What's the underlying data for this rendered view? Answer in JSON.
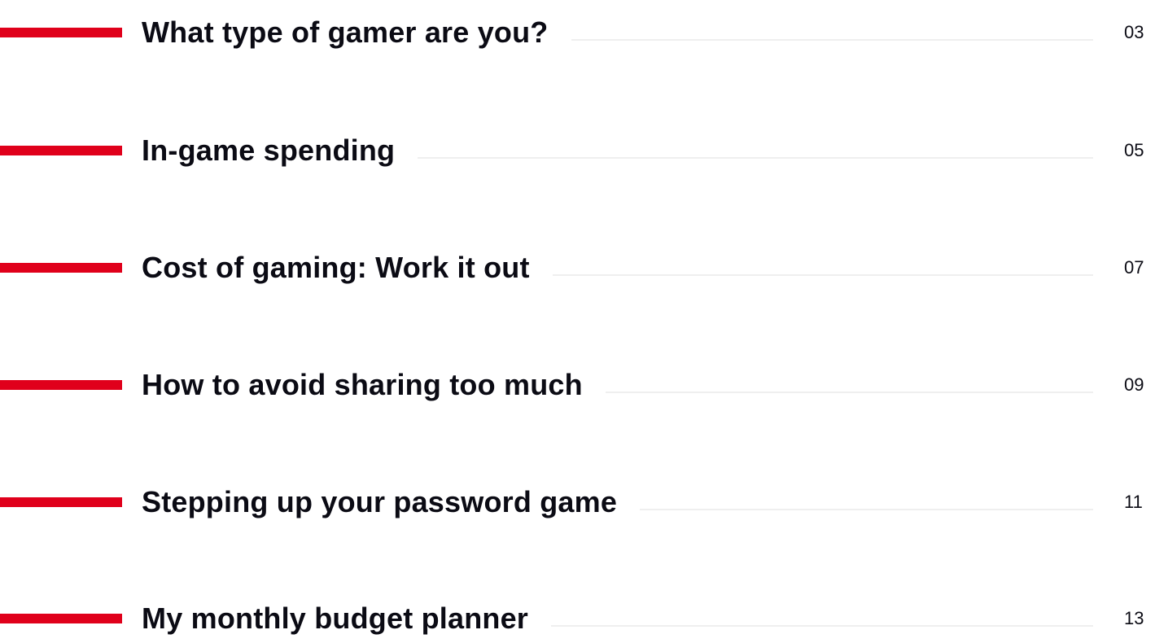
{
  "toc": {
    "accent_color": "#e0001b",
    "entries": [
      {
        "title": "What type of gamer are you?",
        "page": "03"
      },
      {
        "title": "In-game spending",
        "page": "05"
      },
      {
        "title": "Cost of gaming: Work it out",
        "page": "07"
      },
      {
        "title": "How to avoid sharing too much",
        "page": "09"
      },
      {
        "title": "Stepping up your password game",
        "page": "11"
      },
      {
        "title": "My monthly budget planner",
        "page": "13"
      }
    ]
  }
}
